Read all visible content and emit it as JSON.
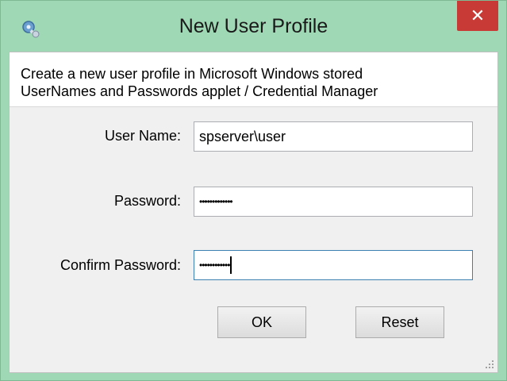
{
  "window": {
    "title": "New User Profile",
    "close_symbol": "✕",
    "app_icon": "key-gear-icon"
  },
  "banner": {
    "line1": "Create a new user profile in Microsoft Windows stored",
    "line2": "UserNames and Passwords applet / Credential Manager"
  },
  "form": {
    "username_label": "User Name:",
    "username_value": "spserver\\user",
    "password_label": "Password:",
    "password_value": "•••••••••••••",
    "confirm_label": "Confirm Password:",
    "confirm_value": "••••••••••••"
  },
  "buttons": {
    "ok_label": "OK",
    "reset_label": "Reset"
  },
  "colors": {
    "titlebar": "#9fd8b4",
    "close_button": "#c73a35",
    "focus_border": "#3c7fb1"
  }
}
